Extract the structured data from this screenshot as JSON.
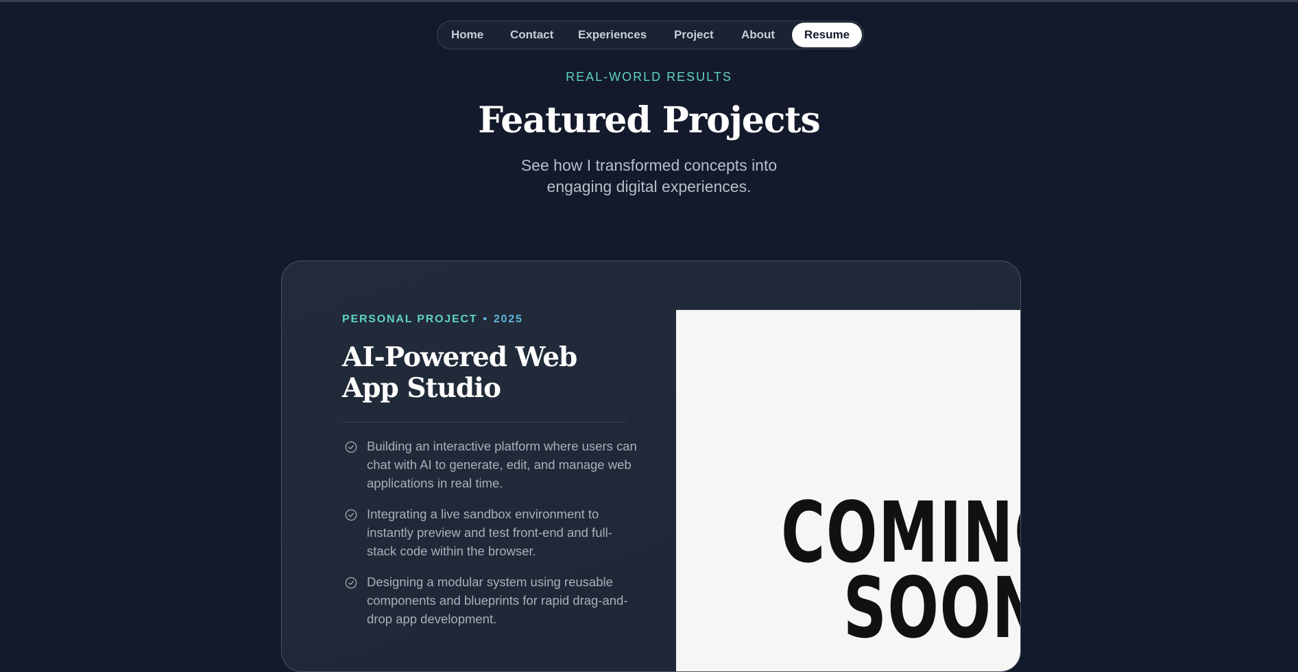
{
  "nav": {
    "items": [
      "Home",
      "Contact",
      "Experiences",
      "Project",
      "About"
    ],
    "resume": "Resume"
  },
  "section": {
    "eyebrow": "REAL-WORLD RESULTS",
    "title": "Featured Projects",
    "subtitle_line1": "See how I transformed concepts into",
    "subtitle_line2": "engaging digital experiences."
  },
  "project": {
    "category": "PERSONAL PROJECT",
    "separator": "•",
    "year": "2025",
    "title": "AI-Powered Web App Studio",
    "bullets": [
      "Building an interactive platform where users can chat with AI to generate, edit, and manage web applications in real time.",
      "Integrating a live sandbox environment to instantly preview and test front-end and full-stack code within the browser.",
      "Designing a modular system using reusable components and blueprints for rapid drag-and-drop app development."
    ],
    "preview_line1": "COMING",
    "preview_line2": "SOON"
  },
  "colors": {
    "background": "#131a2b",
    "accent_teal": "#5fd4c2",
    "accent_blue": "#5fb9e0"
  }
}
